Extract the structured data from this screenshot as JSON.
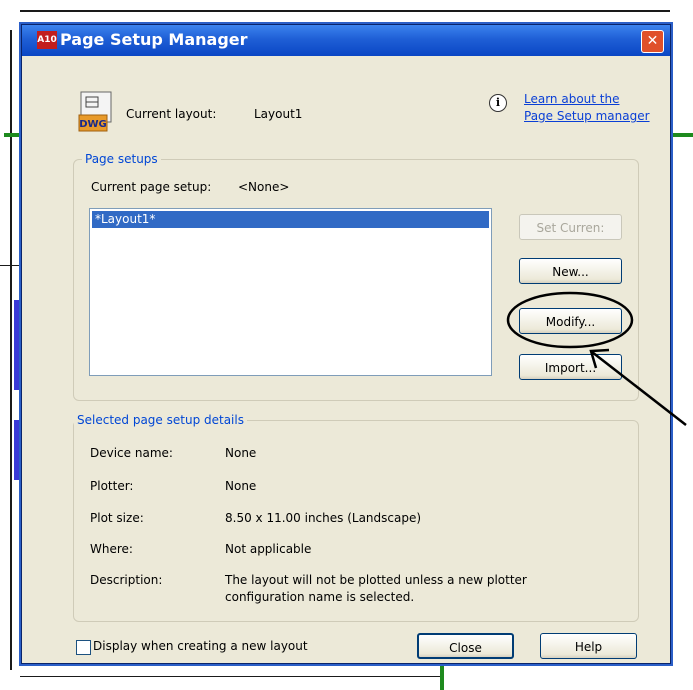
{
  "window": {
    "title": "Page Setup Manager",
    "app_logo_text": "A10",
    "close_symbol": "✕"
  },
  "header": {
    "current_layout_label": "Current layout:",
    "current_layout_value": "Layout1",
    "dwg_icon_text": "DWG",
    "info_icon": "i",
    "learn_link_line1": "Learn about the",
    "learn_link_line2": "Page Setup manager"
  },
  "page_setups": {
    "group_label": "Page setups",
    "current_label": "Current page setup:",
    "current_value": "<None>",
    "items": [
      "*Layout1*"
    ],
    "buttons": {
      "set_current": "Set Curren:",
      "new": "New...",
      "modify": "Modify...",
      "import": "Import..."
    }
  },
  "details": {
    "group_label": "Selected page setup details",
    "device_name_label": "Device name:",
    "device_name_value": "None",
    "plotter_label": "Plotter:",
    "plotter_value": "None",
    "plot_size_label": "Plot size:",
    "plot_size_value": "8.50 x 11.00 inches (Landscape)",
    "where_label": "Where:",
    "where_value": "Not applicable",
    "description_label": "Description:",
    "description_line1": "The layout will not be plotted unless a new plotter",
    "description_line2": "configuration name is selected."
  },
  "footer": {
    "checkbox_label": "Display when creating a new layout",
    "checkbox_checked": false,
    "close": "Close",
    "help": "Help"
  },
  "colors": {
    "titlebar": "#0a46c4",
    "selection": "#316ac5",
    "group_label": "#0046d5",
    "link": "#0a3fd6",
    "close_button": "#e0502a"
  }
}
